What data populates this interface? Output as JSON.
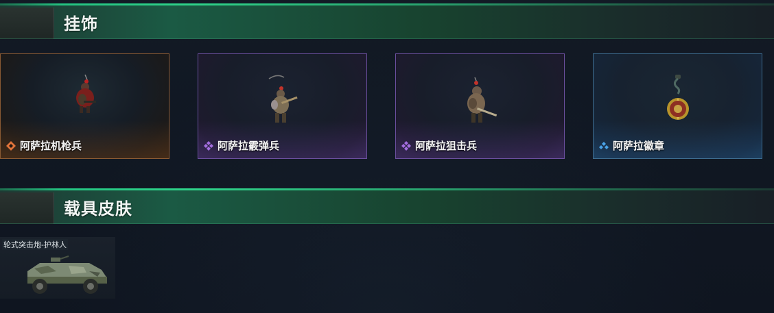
{
  "sections": [
    {
      "title": "挂饰"
    },
    {
      "title": "载具皮肤"
    }
  ],
  "charms": [
    {
      "name": "阿萨拉机枪兵",
      "rarity": "orange",
      "rarity_color": "#e0733a",
      "icon": "orange-diamond-icon"
    },
    {
      "name": "阿萨拉霰弹兵",
      "rarity": "purple",
      "rarity_color": "#a46ee0",
      "icon": "purple-diamond-icon"
    },
    {
      "name": "阿萨拉狙击兵",
      "rarity": "purple",
      "rarity_color": "#a46ee0",
      "icon": "purple-diamond-icon"
    },
    {
      "name": "阿萨拉徽章",
      "rarity": "blue",
      "rarity_color": "#4aa3e8",
      "icon": "blue-diamond-icon"
    }
  ],
  "vehicle_skins": [
    {
      "name": "轮式突击炮-护林人"
    }
  ],
  "colors": {
    "header_accent": "#2fd38a",
    "background": "#101621"
  }
}
